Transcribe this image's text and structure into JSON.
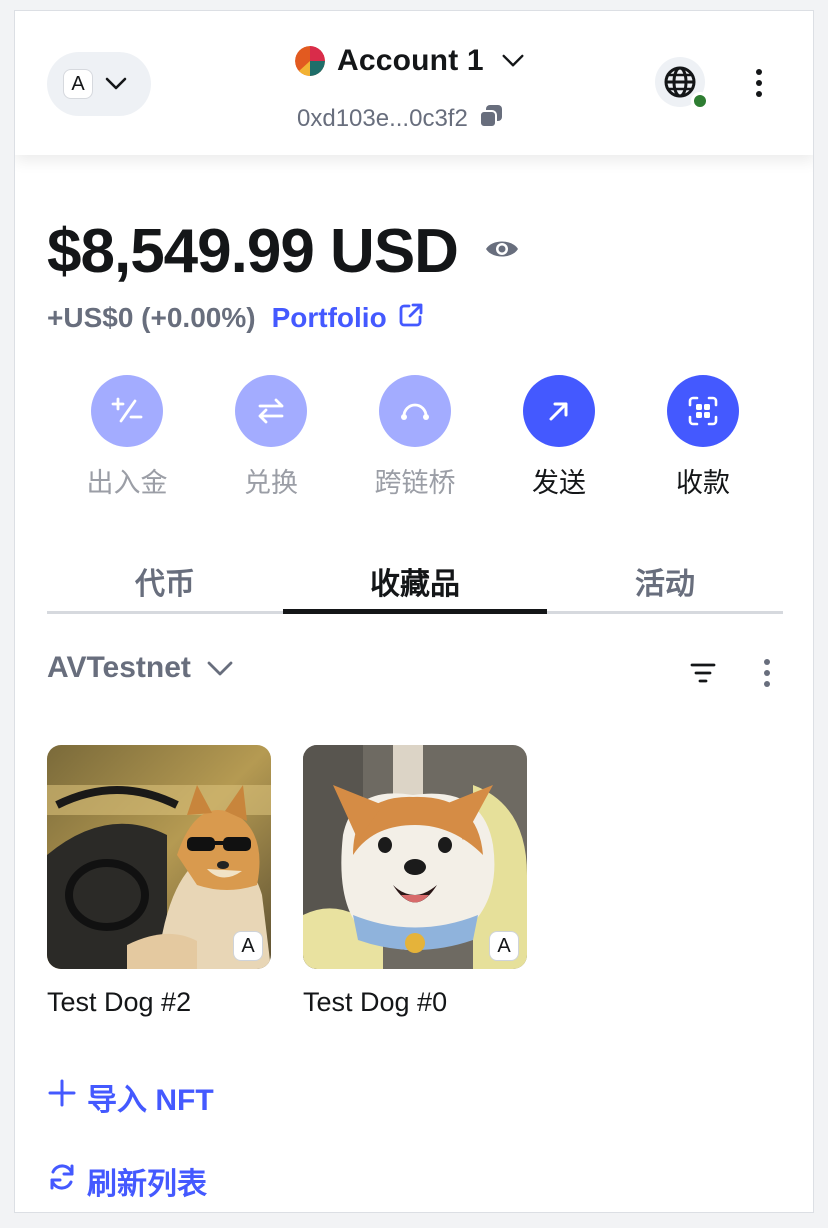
{
  "header": {
    "network_initial": "A",
    "account_name": "Account 1",
    "address": "0xd103e...0c3f2"
  },
  "balance": {
    "amount": "$8,549.99 USD",
    "change": "+US$0 (+0.00%)",
    "portfolio_label": "Portfolio"
  },
  "actions": [
    {
      "label": "出入金",
      "state": "disabled"
    },
    {
      "label": "兑换",
      "state": "disabled"
    },
    {
      "label": "跨链桥",
      "state": "disabled"
    },
    {
      "label": "发送",
      "state": "enabled"
    },
    {
      "label": "收款",
      "state": "enabled"
    }
  ],
  "tabs": [
    {
      "label": "代币"
    },
    {
      "label": "收藏品"
    },
    {
      "label": "活动"
    }
  ],
  "active_tab": "收藏品",
  "collectibles": {
    "network": "AVTestnet",
    "items": [
      {
        "name": "Test Dog #2",
        "badge": "A"
      },
      {
        "name": "Test Dog #0",
        "badge": "A"
      }
    ],
    "import_label": "导入 NFT",
    "refresh_label": "刷新列表"
  },
  "colors": {
    "accent": "#4459ff",
    "accent_muted": "#a3acff",
    "online": "#2e7d32",
    "text_muted": "#686e7d"
  }
}
